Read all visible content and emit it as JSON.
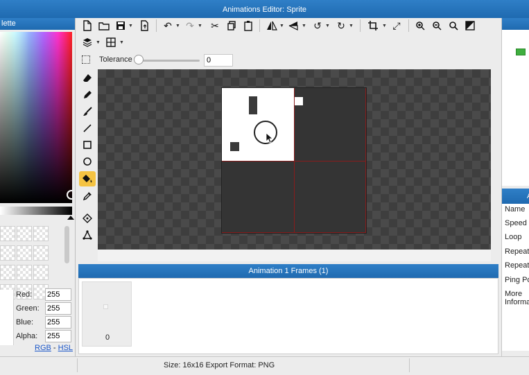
{
  "window": {
    "title": "Animations Editor: Sprite"
  },
  "palette": {
    "header": "lette",
    "red_label": "Red:",
    "red_value": "255",
    "green_label": "Green:",
    "green_value": "255",
    "blue_label": "Blue:",
    "blue_value": "255",
    "alpha_label": "Alpha:",
    "alpha_value": "255",
    "rgb_link": "RGB",
    "separator": " - ",
    "hsl_link": "HSL"
  },
  "toolbar": {
    "icons": [
      "new-file-icon",
      "open-folder-icon",
      "save-icon",
      "export-icon",
      "undo-icon",
      "redo-icon",
      "cut-icon",
      "copy-icon",
      "paste-icon",
      "flip-horizontal-icon",
      "flip-vertical-icon",
      "rotate-ccw-icon",
      "rotate-cw-icon",
      "crop-icon",
      "resize-icon",
      "zoom-in-icon",
      "zoom-out-icon",
      "zoom-fit-icon",
      "toggle-background-icon",
      "layers-icon",
      "grid-icon"
    ]
  },
  "options": {
    "tolerance_label": "Tolerance",
    "tolerance_value": "0",
    "tolerance_level": 0
  },
  "tools": {
    "items": [
      "eraser-icon",
      "pencil-icon",
      "brush-icon",
      "line-icon",
      "rectangle-icon",
      "ellipse-icon",
      "fill-bucket-icon",
      "eyedropper-icon",
      "move-icon",
      "shape-icon"
    ],
    "active": "fill-bucket-icon"
  },
  "frames": {
    "header": "Animation 1 Frames (1)",
    "frame_number": "0"
  },
  "properties": {
    "header": "A",
    "rows": [
      "Name",
      "Speed",
      "Loop",
      "Repeat",
      "Repeat",
      "Ping Po",
      "More",
      "Informa"
    ]
  },
  "status": {
    "text": "Size: 16x16   Export Format: PNG"
  },
  "colors": {
    "accent": "#1f6ab0",
    "active_tool": "#f5c342",
    "grid_line": "#8a1c1c"
  }
}
